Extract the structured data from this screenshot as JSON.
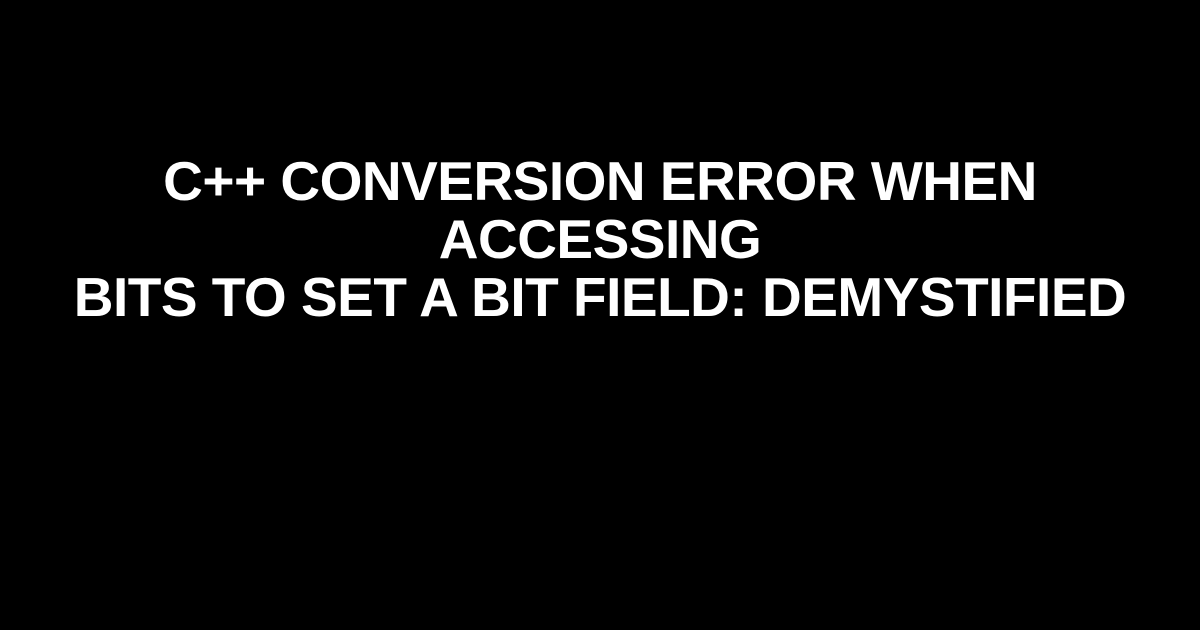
{
  "title": {
    "line1": "C++ CONVERSION ERROR WHEN ACCESSING",
    "line2": "BITS TO SET A BIT FIELD: DEMYSTIFIED"
  }
}
